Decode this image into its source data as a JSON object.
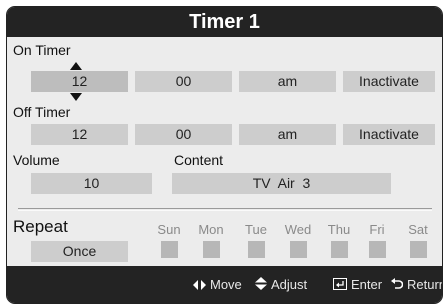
{
  "dialog": {
    "title": "Timer 1"
  },
  "on_timer": {
    "label": "On Timer",
    "hour": "12",
    "minute": "00",
    "ampm": "am",
    "state": "Inactivate"
  },
  "off_timer": {
    "label": "Off Timer",
    "hour": "12",
    "minute": "00",
    "ampm": "am",
    "state": "Inactivate"
  },
  "volume": {
    "label": "Volume",
    "value": "10"
  },
  "content": {
    "label": "Content",
    "value": "TV  Air  3"
  },
  "repeat": {
    "label": "Repeat",
    "value": "Once",
    "days": [
      "Sun",
      "Mon",
      "Tue",
      "Wed",
      "Thu",
      "Fri",
      "Sat"
    ]
  },
  "footer": {
    "move": "Move",
    "adjust": "Adjust",
    "enter": "Enter",
    "return": "Return"
  },
  "icons": {
    "move": "left-right-arrows-icon",
    "adjust": "up-down-arrows-icon",
    "enter": "enter-icon",
    "return": "return-icon"
  }
}
